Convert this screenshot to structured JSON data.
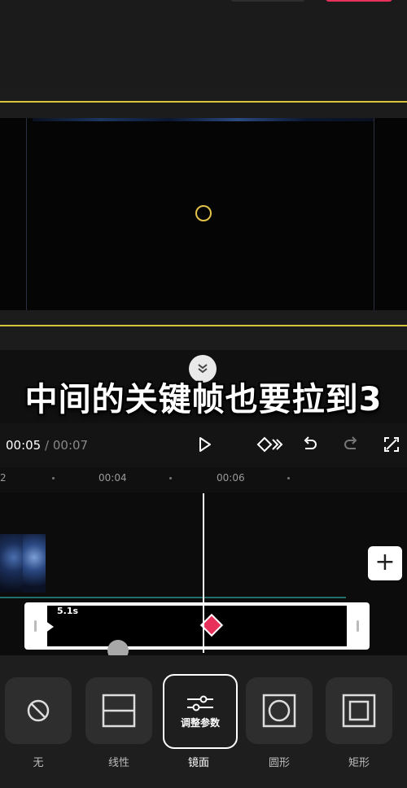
{
  "caption": "中间的关键帧也要拉到3",
  "timecode": {
    "current": "00:05",
    "separator": "/",
    "total": "00:07"
  },
  "ruler": {
    "labels": [
      "2",
      "00:04",
      "00:06"
    ]
  },
  "mask_clip": {
    "duration": "5.1s"
  },
  "add_button": "+",
  "controls": {
    "play": "play-icon",
    "keyframe": "keyframe-icon",
    "undo": "undo-icon",
    "redo": "redo-icon",
    "fullscreen": "fullscreen-icon"
  },
  "mask_options": [
    {
      "label": "无",
      "icon": "none-icon"
    },
    {
      "label": "线性",
      "icon": "linear-icon"
    },
    {
      "label": "镜面",
      "icon": "mirror-icon",
      "selected_label": "调整参数",
      "selected": true
    },
    {
      "label": "圆形",
      "icon": "circle-icon"
    },
    {
      "label": "矩形",
      "icon": "rectangle-icon"
    }
  ],
  "colors": {
    "accent": "#e8315a",
    "guide_line": "#d8c43a",
    "ring": "#e3c34a"
  }
}
